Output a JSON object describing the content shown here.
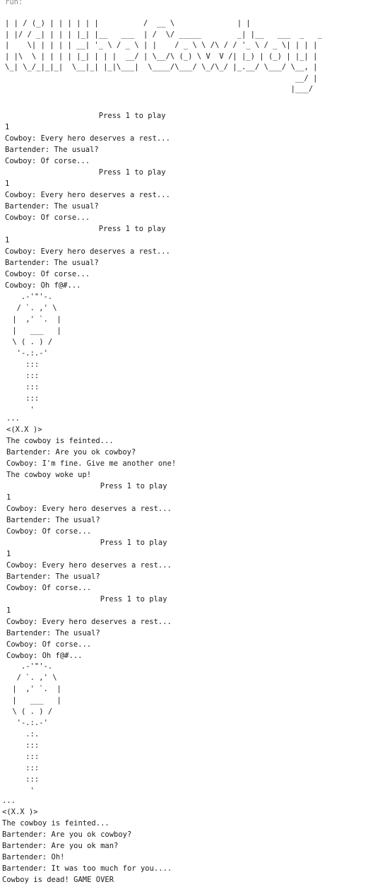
{
  "console": {
    "run_label": "run:",
    "banner": "| | / (_) | | | | | |          /  __ \\              | |\n| |/ / _| | | | |_| |__   ___  | /  \\/ _____        _| |__   ___  _   _\n|    \\| | | | | __| '_ \\ / _ \\ | |    / _ \\ \\ /\\ / / '_ \\ / _ \\| | | |\n| |\\  \\ | | | | |_| | | |  __/ | \\__/\\ (_) \\ V  V /| |_) | (_) | |_| |\n\\_| \\_/_|_|_|  \\__|_| |_|\\___|  \\____/\\___/ \\_/\\_/ |_.__/ \\___/ \\__, |\n                                                                 __/ |\n                                                                |___/",
    "block1": [
      "                     Press 1 to play",
      "1",
      "Cowboy: Every hero deserves a rest...",
      "Bartender: The usual?",
      "Cowboy: Of corse...",
      "                     Press 1 to play",
      "1",
      "Cowboy: Every hero deserves a rest...",
      "Bartender: The usual?",
      "Cowboy: Of corse...",
      "                     Press 1 to play",
      "1",
      "Cowboy: Every hero deserves a rest...",
      "Bartender: The usual?",
      "Cowboy: Of corse...",
      "Cowboy: Oh f@#..."
    ],
    "art1": "   .-'\"'-.\n  / `. ,' \\\n |  ,' `.  |\n |   ___   |\n \\ ( . ) /\n  '-.:.-'\n    :::\n    :::\n    :::\n    :::\n     '",
    "block2": [
      "...",
      "<(X.X )>",
      "The cowboy is feinted...",
      "Bartender: Are you ok cowboy?",
      "Cowboy: I'm fine. Give me another one!",
      "The cowboy woke up!",
      "                     Press 1 to play",
      "1",
      "Cowboy: Every hero deserves a rest...",
      "Bartender: The usual?",
      "Cowboy: Of corse...",
      "                     Press 1 to play",
      "1",
      "Cowboy: Every hero deserves a rest...",
      "Bartender: The usual?",
      "Cowboy: Of corse...",
      "                     Press 1 to play",
      "1",
      "Cowboy: Every hero deserves a rest...",
      "Bartender: The usual?",
      "Cowboy: Of corse...",
      "Cowboy: Oh f@#..."
    ],
    "art2": "   .-'\"'-.\n  / `. ,' \\\n |  ,' `.  |\n |   ___   |\n \\ ( . ) /\n  '-.:.-'\n    .:.\n    :::\n    :::\n    :::\n    :::\n     '",
    "block3": [
      "...",
      "<(X.X )>",
      "The cowboy is feinted...",
      "Bartender: Are you ok cowboy?",
      "Bartender: Are you ok man?",
      "Bartender: Oh!",
      "Bartender: It was too much for you....",
      "Cowboy is dead! GAME OVER"
    ]
  }
}
